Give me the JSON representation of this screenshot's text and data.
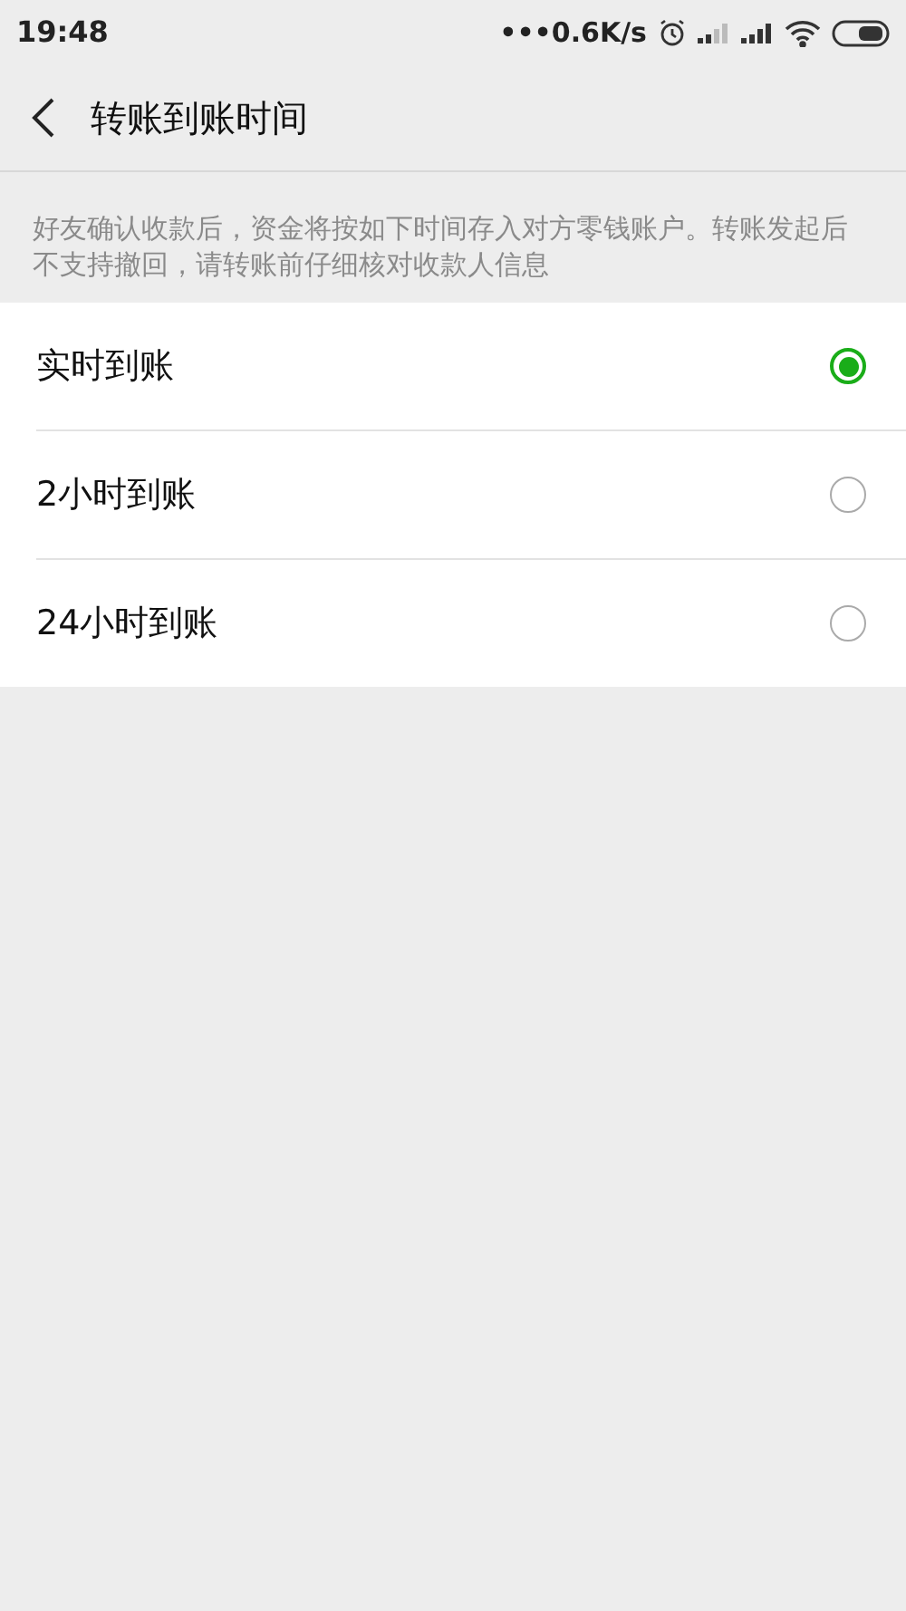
{
  "status_bar": {
    "time": "19:48",
    "speed": "•••0.6K/s"
  },
  "header": {
    "title": "转账到账时间"
  },
  "notice": "好友确认收款后，资金将按如下时间存入对方零钱账户。转账发起后不支持撤回，请转账前仔细核对收款人信息",
  "options": [
    {
      "label": "实时到账",
      "selected": true
    },
    {
      "label": "2小时到账",
      "selected": false
    },
    {
      "label": "24小时到账",
      "selected": false
    }
  ]
}
